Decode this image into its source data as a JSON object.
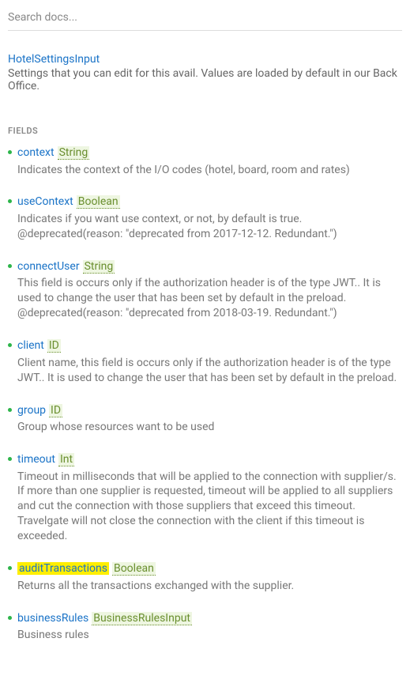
{
  "search": {
    "placeholder": "Search docs..."
  },
  "type": {
    "name": "HotelSettingsInput",
    "description": "Settings that you can edit for this avail. Values are loaded by default in our Back Office."
  },
  "section_label": "FIELDS",
  "fields": [
    {
      "name": "context",
      "type": "String",
      "highlighted": false,
      "description": "Indicates the context of the I/O codes (hotel, board, room and rates)"
    },
    {
      "name": "useContext",
      "type": "Boolean",
      "highlighted": false,
      "description": "Indicates if you want use context, or not, by default is true. @deprecated(reason: \"deprecated from 2017-12-12. Redundant.\")"
    },
    {
      "name": "connectUser",
      "type": "String",
      "highlighted": false,
      "description": "This field is occurs only if the authorization header is of the type JWT.. It is used to change the user that has been set by default in the preload. @deprecated(reason: \"deprecated from 2018-03-19. Redundant.\")"
    },
    {
      "name": "client",
      "type": "ID",
      "highlighted": false,
      "description": "Client name, this field is occurs only if the authorization header is of the type JWT.. It is used to change the user that has been set by default in the preload."
    },
    {
      "name": "group",
      "type": "ID",
      "highlighted": false,
      "description": "Group whose resources want to be used"
    },
    {
      "name": "timeout",
      "type": "Int",
      "highlighted": false,
      "description": "Timeout in milliseconds that will be applied to the connection with supplier/s. If more than one supplier is requested, timeout will be applied to all suppliers and cut the connection with those suppliers that exceed this timeout. Travelgate will not close the connection with the client if this timeout is exceeded."
    },
    {
      "name": "auditTransactions",
      "type": "Boolean",
      "highlighted": true,
      "description": "Returns all the transactions exchanged with the supplier."
    },
    {
      "name": "businessRules",
      "type": "BusinessRulesInput",
      "highlighted": false,
      "description": "Business rules"
    }
  ]
}
